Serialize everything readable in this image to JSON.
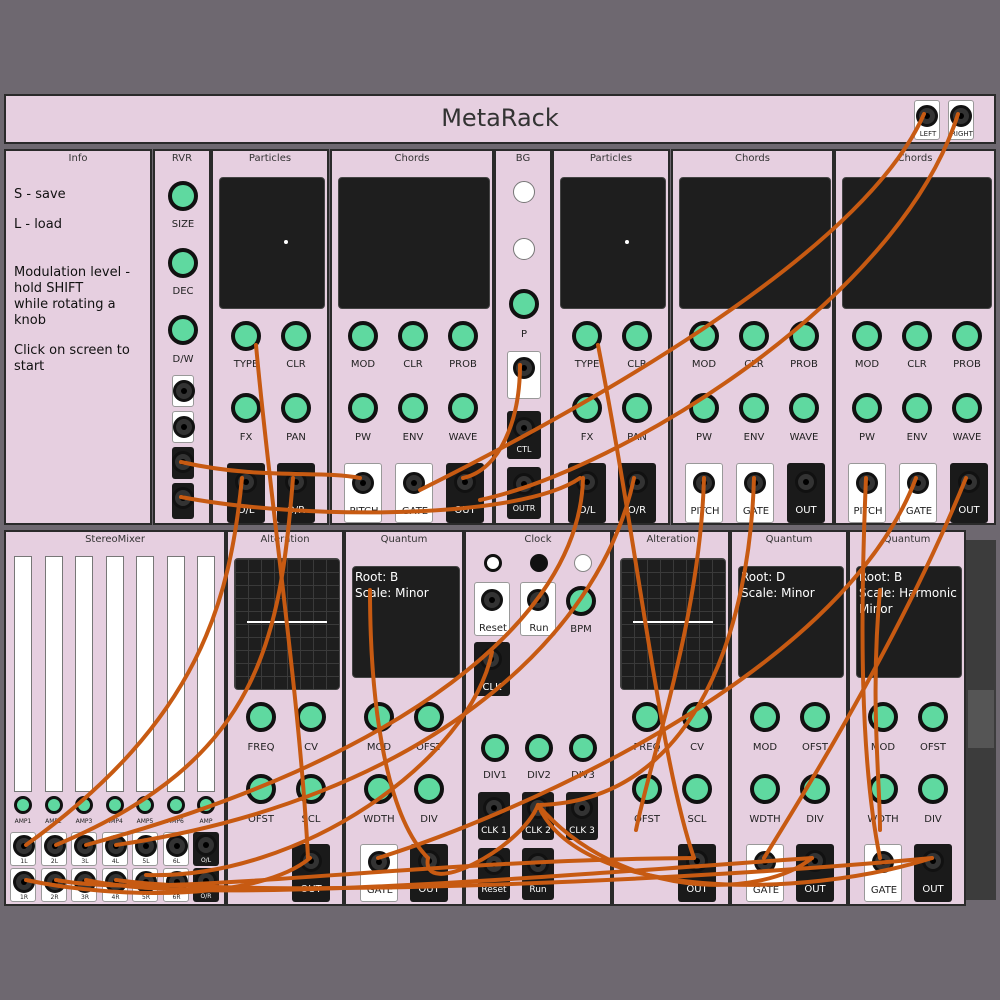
{
  "app": {
    "title": "MetaRack"
  },
  "master": {
    "left": "LEFT",
    "right": "RIGHT"
  },
  "info": {
    "title": "Info",
    "save": "S - save",
    "load": "L - load",
    "mod1": "Modulation level -",
    "mod2": "hold SHIFT",
    "mod3": "while rotating a knob",
    "start": "Click on screen to start"
  },
  "rvr": {
    "title": "RVR",
    "size": "SIZE",
    "dec": "DEC",
    "dw": "D/W"
  },
  "particles": {
    "title": "Particles",
    "type": "TYPE",
    "clr": "CLR",
    "fx": "FX",
    "pan": "PAN",
    "ol": "O/L",
    "or": "O/R"
  },
  "chords": {
    "title": "Chords",
    "mod": "MOD",
    "clr": "CLR",
    "prob": "PROB",
    "pw": "PW",
    "env": "ENV",
    "wave": "WAVE",
    "pitch": "PITCH",
    "gate": "GATE",
    "out": "OUT"
  },
  "bg": {
    "title": "BG",
    "p": "P",
    "ctl": "CTL",
    "outr": "OUTR"
  },
  "mixer": {
    "title": "StereoMixer",
    "amps": [
      "AMP1",
      "AMP2",
      "AMP3",
      "AMP4",
      "AMP5",
      "AMP6",
      "AMP"
    ],
    "left": [
      "1L",
      "2L",
      "3L",
      "4L",
      "5L",
      "6L",
      "O/L"
    ],
    "right": [
      "1R",
      "2R",
      "3R",
      "4R",
      "5R",
      "6R",
      "O/R"
    ]
  },
  "alteration": {
    "title": "Alteration",
    "freq": "FREQ",
    "cv": "CV",
    "ofst": "OFST",
    "scl": "SCL",
    "out": "OUT"
  },
  "quantum": {
    "title": "Quantum",
    "mod": "MOD",
    "ofst": "OFST",
    "wdth": "WDTH",
    "div": "DIV",
    "gate": "GATE",
    "out": "OUT"
  },
  "quantum_screens": [
    {
      "root": "Root: B",
      "scale": "Scale: Minor",
      "extra": ""
    },
    {
      "root": "Root: D",
      "scale": "Scale: Minor",
      "extra": ""
    },
    {
      "root": "Root: B",
      "scale": "Scale: Harmonic",
      "extra": "Minor"
    }
  ],
  "clock": {
    "title": "Clock",
    "reset": "Reset",
    "run": "Run",
    "bpm": "BPM",
    "clk": "CLK",
    "div1": "DIV1",
    "div2": "DIV2",
    "div3": "DIV3",
    "clk1": "CLK 1",
    "clk2": "CLK 2",
    "clk3": "CLK 3"
  },
  "colors": {
    "panel": "#e6cfe0",
    "knob": "#5fd9a0",
    "cable": "#c75a12",
    "background": "#6e6870"
  }
}
